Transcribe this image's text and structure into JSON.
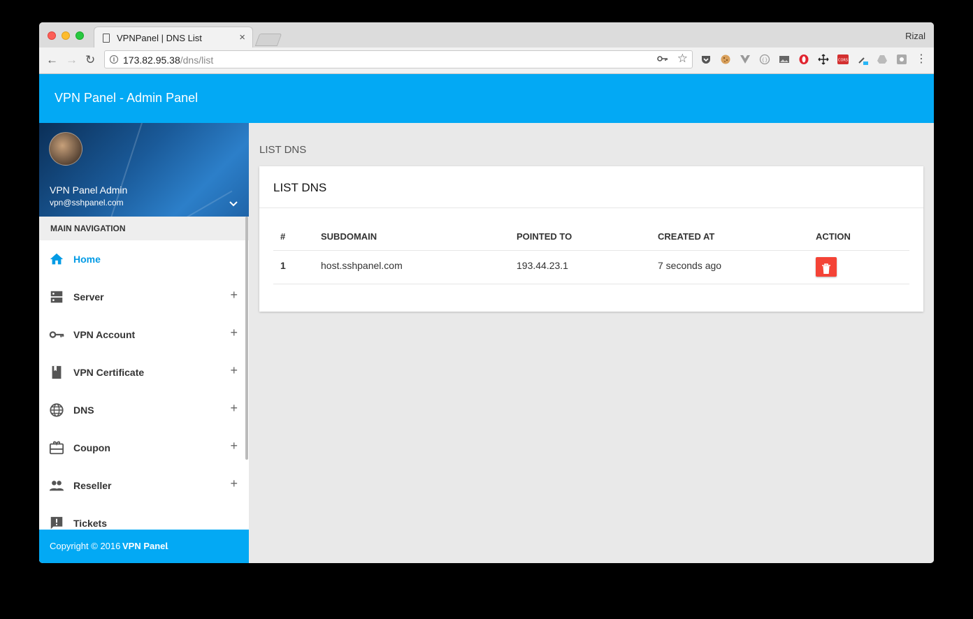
{
  "browser": {
    "tab_title": "VPNPanel | DNS List",
    "tab_close": "×",
    "user_name": "Rizal",
    "url_host": "173.82.95.38",
    "url_path": "/dns/list",
    "info_icon": "i",
    "back": "←",
    "forward": "→",
    "reload": "↻",
    "menu_dots": "⋮"
  },
  "app": {
    "brand": "VPN Panel - Admin Panel"
  },
  "sidebar": {
    "admin_name": "VPN Panel Admin",
    "admin_email": "vpn@sshpanel.com",
    "nav_header": "MAIN NAVIGATION",
    "items": [
      {
        "label": "Home",
        "icon": "home-icon",
        "active": true
      },
      {
        "label": "Server",
        "icon": "server-icon",
        "expand": "+"
      },
      {
        "label": "VPN Account",
        "icon": "key-icon",
        "expand": "+"
      },
      {
        "label": "VPN Certificate",
        "icon": "book-icon",
        "expand": "+"
      },
      {
        "label": "DNS",
        "icon": "globe-icon",
        "expand": "+"
      },
      {
        "label": "Coupon",
        "icon": "gift-card-icon",
        "expand": "+"
      },
      {
        "label": "Reseller",
        "icon": "people-icon",
        "expand": "+"
      },
      {
        "label": "Tickets",
        "icon": "feedback-icon"
      }
    ],
    "footer_prefix": "Copyright © 2016",
    "footer_brand": "VPN Panel",
    "footer_suffix": "."
  },
  "content": {
    "breadcrumb": "LIST DNS",
    "card_title": "LIST DNS",
    "table": {
      "headers": [
        "#",
        "SUBDOMAIN",
        "POINTED TO",
        "CREATED AT",
        "ACTION"
      ],
      "rows": [
        {
          "num": "1",
          "subdomain": "host.sshpanel.com",
          "pointed_to": "193.44.23.1",
          "created_at": "7 seconds ago"
        }
      ]
    }
  },
  "colors": {
    "primary": "#03a9f4",
    "active": "#039be5",
    "danger": "#f44336"
  }
}
